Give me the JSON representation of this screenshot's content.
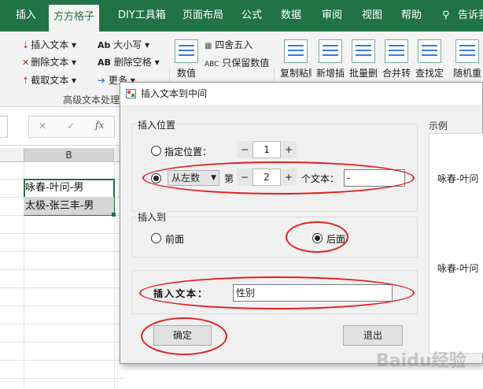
{
  "ribbon": {
    "tabs": [
      "插入",
      "方方格子",
      "DIY工具箱",
      "页面布局",
      "公式",
      "数据",
      "审阅",
      "视图",
      "帮助"
    ],
    "active_tab": "方方格子",
    "search_label": "告诉我",
    "group1": {
      "insert_text": "插入文本",
      "delete_text": "删除文本",
      "cut_text": "截取文本"
    },
    "group2": {
      "case": "大小写",
      "delete_space": "删除空格",
      "more": "更多"
    },
    "group_label": "高级文本处理",
    "numeric": {
      "label": "数值",
      "round": "四舍五入",
      "keep_numeric": "只保留数值"
    },
    "big_buttons": [
      "复制粘贴",
      "新增插",
      "批量删",
      "合并转",
      "查找定",
      "随机重"
    ]
  },
  "formula_bar": {
    "fx": "fx"
  },
  "sheet": {
    "column_header": "B",
    "cells": [
      "咏春-叶问-男",
      "太极-张三丰-男"
    ]
  },
  "dialog": {
    "title": "插入文本到中间",
    "section_position": "插入位置",
    "radio_specified": "指定位置：",
    "specified_value": "1",
    "combo_value": "从左数",
    "nth_prefix": "第",
    "nth_value": "2",
    "nth_suffix": "个文本：",
    "separator_value": "-",
    "section_insert_to": "插入到",
    "radio_front": "前面",
    "radio_back": "后面",
    "insert_text_label": "插入文本：",
    "insert_text_value": "性别",
    "ok_button": "确定",
    "exit_button": "退出",
    "example_label": "示例",
    "example_before": "咏春-叶问",
    "example_after": "咏春-叶问"
  },
  "watermark": "Baidu经验"
}
